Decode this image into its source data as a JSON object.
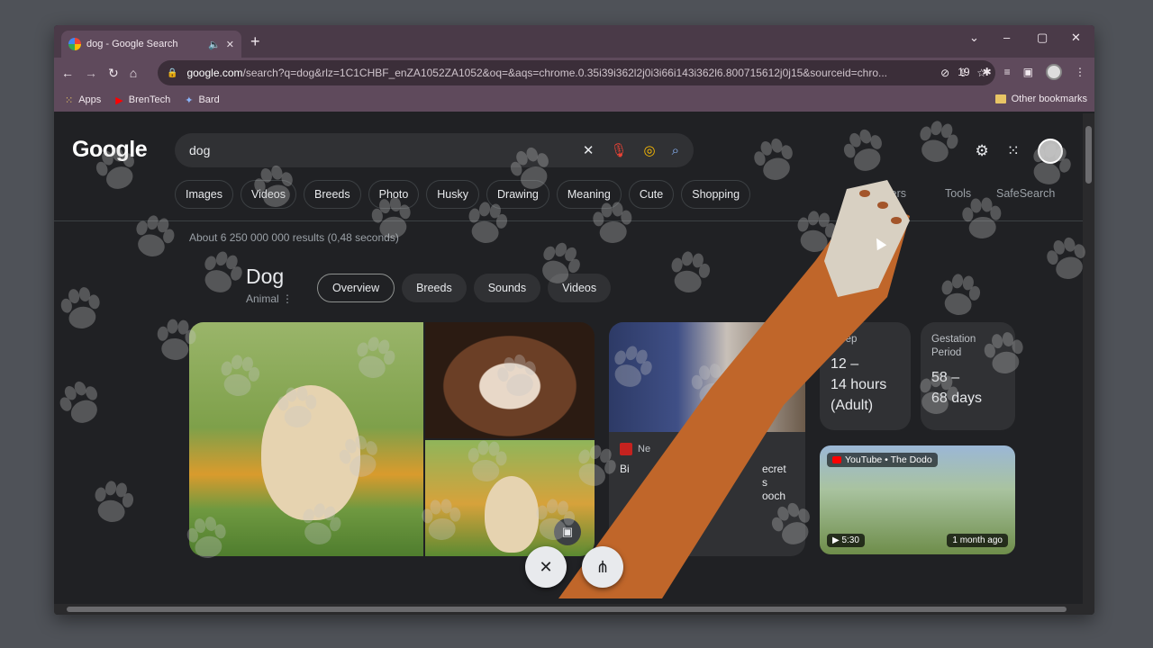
{
  "browser": {
    "tab_title": "dog - Google Search",
    "url_host": "google.com",
    "url_rest": "/search?q=dog&rlz=1C1CHBF_enZA1052ZA1052&oq=&aqs=chrome.0.35i39i362l2j0i3i66i143i362l6.800715612j0j15&sourceid=chro...",
    "extension_count": "19",
    "bookmarks": [
      "Apps",
      "BrenTech",
      "Bard"
    ],
    "other_bookmarks": "Other bookmarks"
  },
  "search": {
    "logo": "Google",
    "query": "dog",
    "chips": [
      "Images",
      "Videos",
      "Breeds",
      "Photo",
      "Husky",
      "Drawing",
      "Meaning",
      "Cute",
      "Shopping"
    ],
    "tools": [
      "Filters",
      "Tools",
      "SafeSearch"
    ],
    "results_count": "About 6 250 000 000 results (0,48 seconds)"
  },
  "knowledge_panel": {
    "title": "Dog",
    "subtitle": "Animal",
    "tabs": [
      "Overview",
      "Breeds",
      "Sounds",
      "Videos"
    ],
    "news": {
      "source": "Ne",
      "text_left": "Bi",
      "text_right": [
        "ecret",
        "s",
        "ooch"
      ]
    },
    "facts": [
      {
        "label": "Sleep",
        "value": [
          "12 –",
          "14 hours",
          "(Adult)"
        ]
      },
      {
        "label": "Gestation Period",
        "value": [
          "58 –",
          "68 days"
        ]
      }
    ],
    "video": {
      "source": "YouTube • The Dodo",
      "duration": "5:30",
      "age": "1 month ago"
    }
  },
  "colors": {
    "accent_frame": "#5f4a5c",
    "page_bg": "#202124",
    "paw": "#c8c8c8",
    "stick": "#c0662a"
  }
}
